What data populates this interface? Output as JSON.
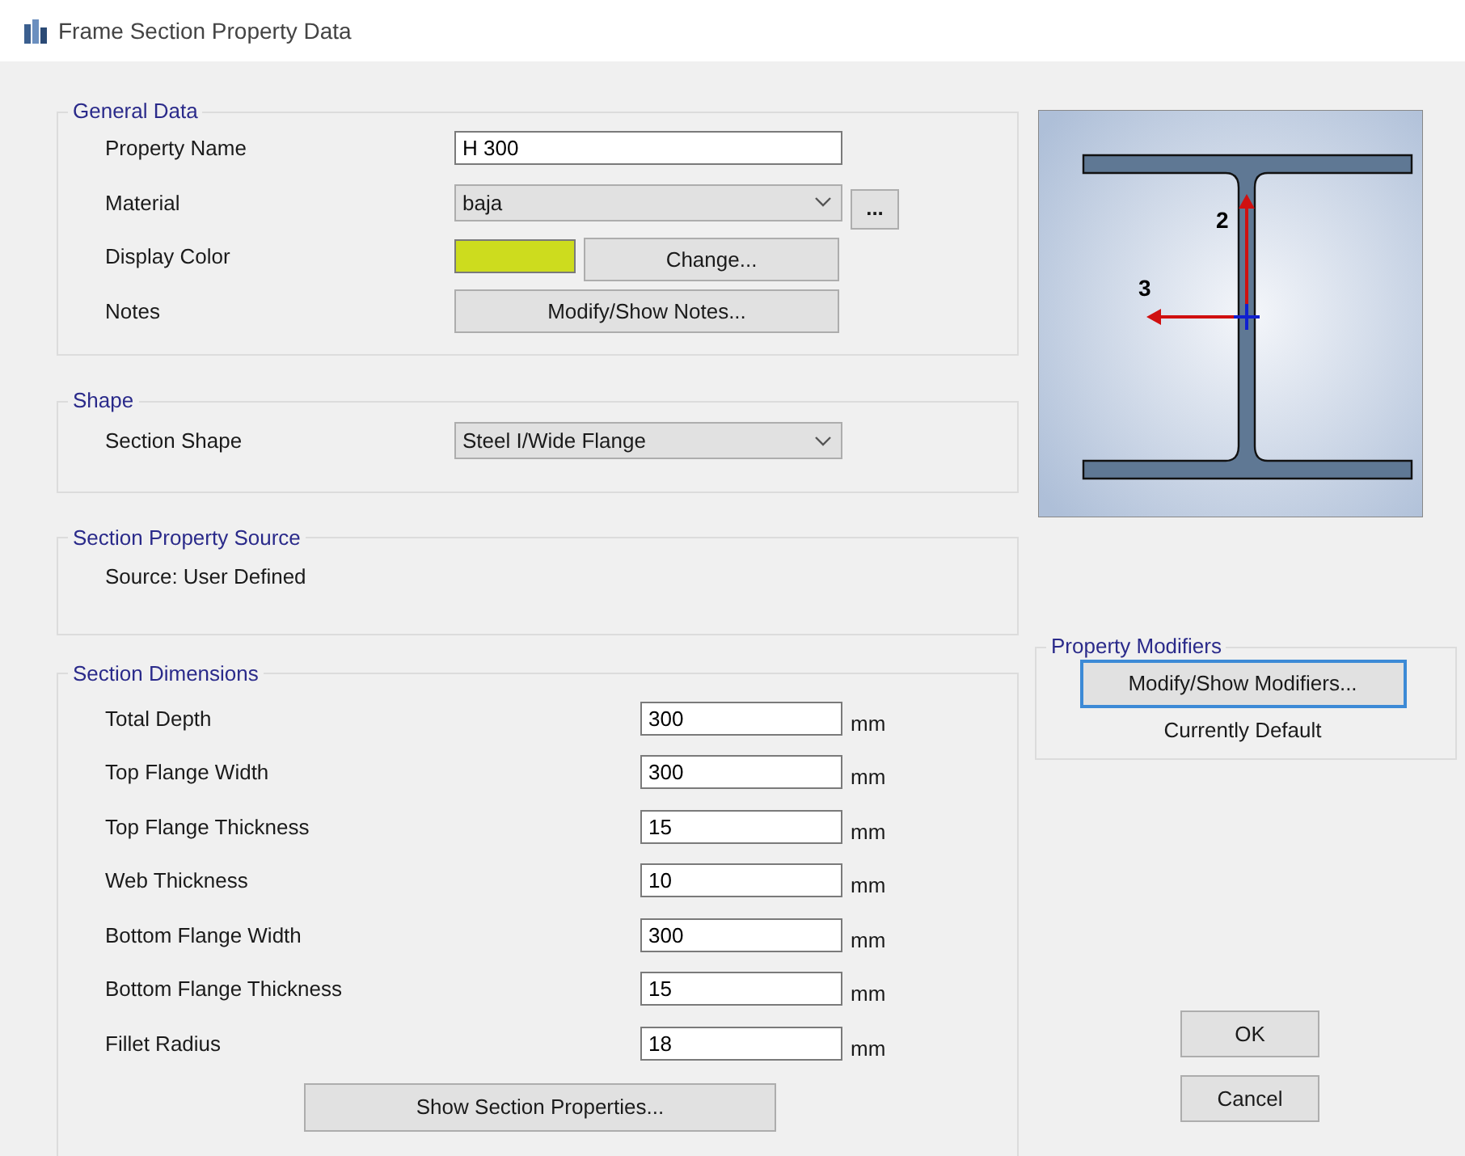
{
  "window": {
    "title": "Frame Section Property Data"
  },
  "general_data": {
    "title": "General Data",
    "fields": [
      {
        "kind": "text",
        "label": "Property Name",
        "value": "H 300"
      },
      {
        "kind": "select",
        "label": "Material",
        "value": "baja",
        "extra_button": "..."
      },
      {
        "kind": "color",
        "label": "Display Color",
        "color": "#cddc1e",
        "button": "Change..."
      },
      {
        "kind": "button",
        "label": "Notes",
        "button": "Modify/Show Notes..."
      }
    ]
  },
  "shape": {
    "title": "Shape",
    "label": "Section Shape",
    "value": "Steel I/Wide Flange"
  },
  "source": {
    "title": "Section Property Source",
    "text": "Source:  User Defined"
  },
  "dimensions": {
    "title": "Section Dimensions",
    "rows": [
      {
        "label": "Total Depth",
        "value": "300",
        "unit": "mm"
      },
      {
        "label": "Top Flange Width",
        "value": "300",
        "unit": "mm"
      },
      {
        "label": "Top Flange Thickness",
        "value": "15",
        "unit": "mm"
      },
      {
        "label": "Web Thickness",
        "value": "10",
        "unit": "mm"
      },
      {
        "label": "Bottom Flange Width",
        "value": "300",
        "unit": "mm"
      },
      {
        "label": "Bottom Flange Thickness",
        "value": "15",
        "unit": "mm"
      },
      {
        "label": "Fillet Radius",
        "value": "18",
        "unit": "mm"
      }
    ],
    "button": "Show Section Properties..."
  },
  "preview": {
    "axis_labels": [
      "2",
      "3"
    ]
  },
  "modifiers": {
    "title": "Property Modifiers",
    "button": "Modify/Show Modifiers...",
    "status": "Currently Default"
  },
  "buttons": [
    "OK",
    "Cancel"
  ]
}
